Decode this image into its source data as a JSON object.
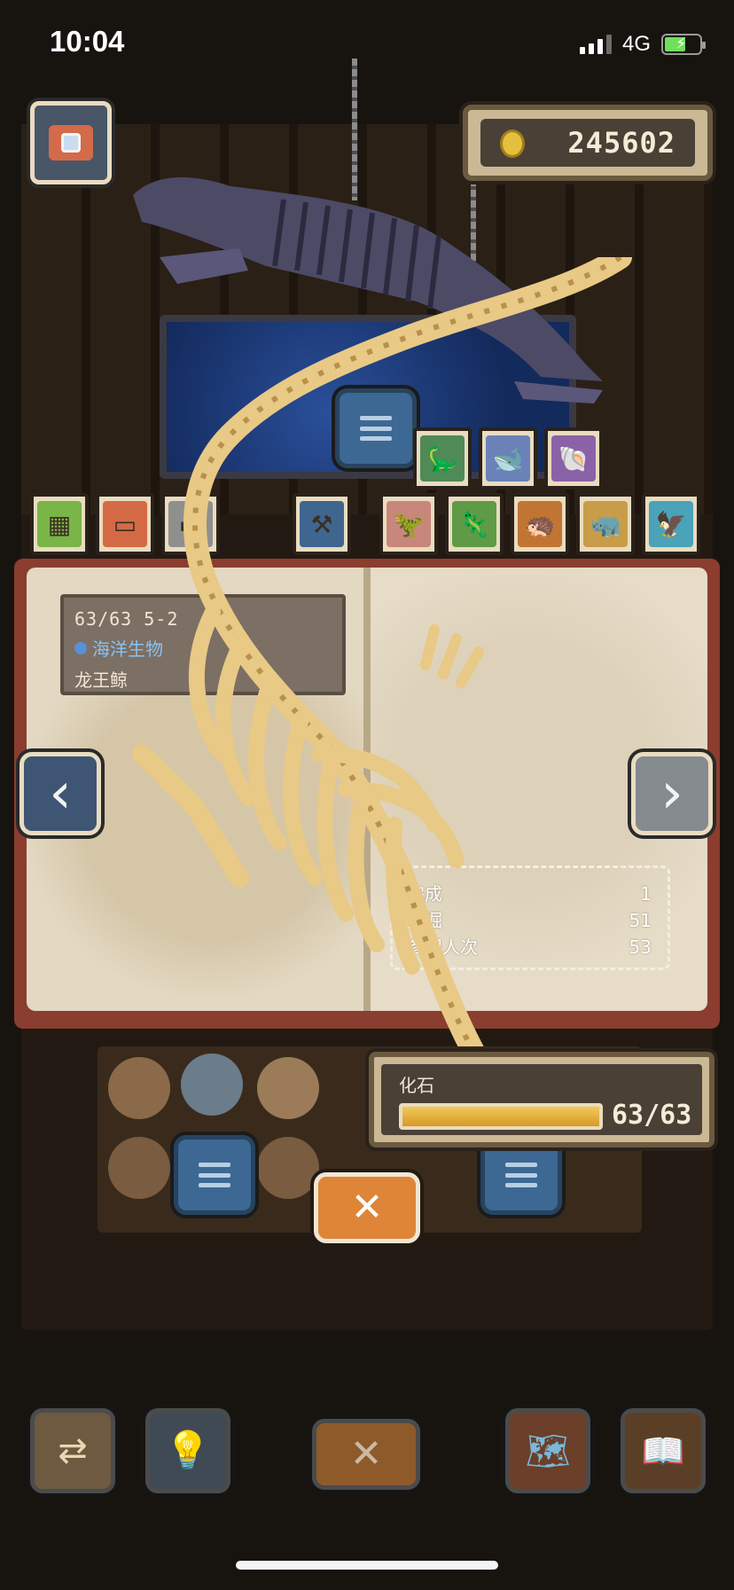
{
  "status_bar": {
    "time": "10:04",
    "network": "4G"
  },
  "coins": {
    "value": "245602"
  },
  "category_tabs_top": [
    {
      "icon": "sauropod-icon",
      "bg": "#4f8a57"
    },
    {
      "icon": "plesiosaur-icon",
      "bg": "#6a82b8"
    },
    {
      "icon": "ammonite-icon",
      "bg": "#8a62a8"
    }
  ],
  "category_tabs_row": [
    {
      "icon": "wood-crate-icon",
      "bg": "#79b547"
    },
    {
      "icon": "treasure-chest-icon",
      "bg": "#d46a45"
    },
    {
      "icon": "stone-block-icon",
      "bg": "#8f8f8f"
    },
    {
      "icon": "hammer-icon",
      "bg": "#3f668f"
    },
    {
      "icon": "theropod-icon",
      "bg": "#c9867a"
    },
    {
      "icon": "raptor-icon",
      "bg": "#5f9a47"
    },
    {
      "icon": "stegosaur-icon",
      "bg": "#c27533"
    },
    {
      "icon": "triceratops-icon",
      "bg": "#c99c4a"
    },
    {
      "icon": "pterosaur-icon",
      "bg": "#4aa3b8"
    }
  ],
  "specimen": {
    "progress": "63/63 5-2",
    "category": "海洋生物",
    "name": "龙王鲸"
  },
  "stats": [
    {
      "label": "完成",
      "value": "1"
    },
    {
      "label": "挖掘",
      "value": "51"
    },
    {
      "label": "参观人次",
      "value": "53"
    }
  ],
  "fossil_panel": {
    "label": "化石",
    "progress_text": "63/63",
    "progress": 1.0
  },
  "bottom_toolbar": [
    {
      "icon": "exchange-icon"
    },
    {
      "icon": "lightbulb-icon"
    },
    {
      "icon": "map-icon"
    },
    {
      "icon": "journal-icon"
    }
  ]
}
